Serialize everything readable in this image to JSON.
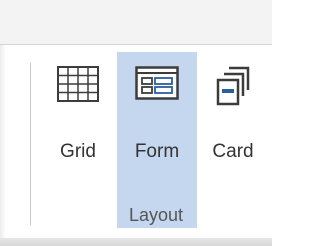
{
  "ribbon": {
    "group": {
      "label": "Layout",
      "buttons": [
        {
          "label": "Grid",
          "icon": "grid-icon",
          "selected": false
        },
        {
          "label": "Form",
          "icon": "form-icon",
          "selected": true
        },
        {
          "label": "Card",
          "icon": "card-icon",
          "selected": false
        }
      ]
    }
  },
  "colors": {
    "selected_background": "#c5d7ee",
    "icon_accent": "#2a5f9e",
    "icon_stroke": "#3c3c3c"
  }
}
